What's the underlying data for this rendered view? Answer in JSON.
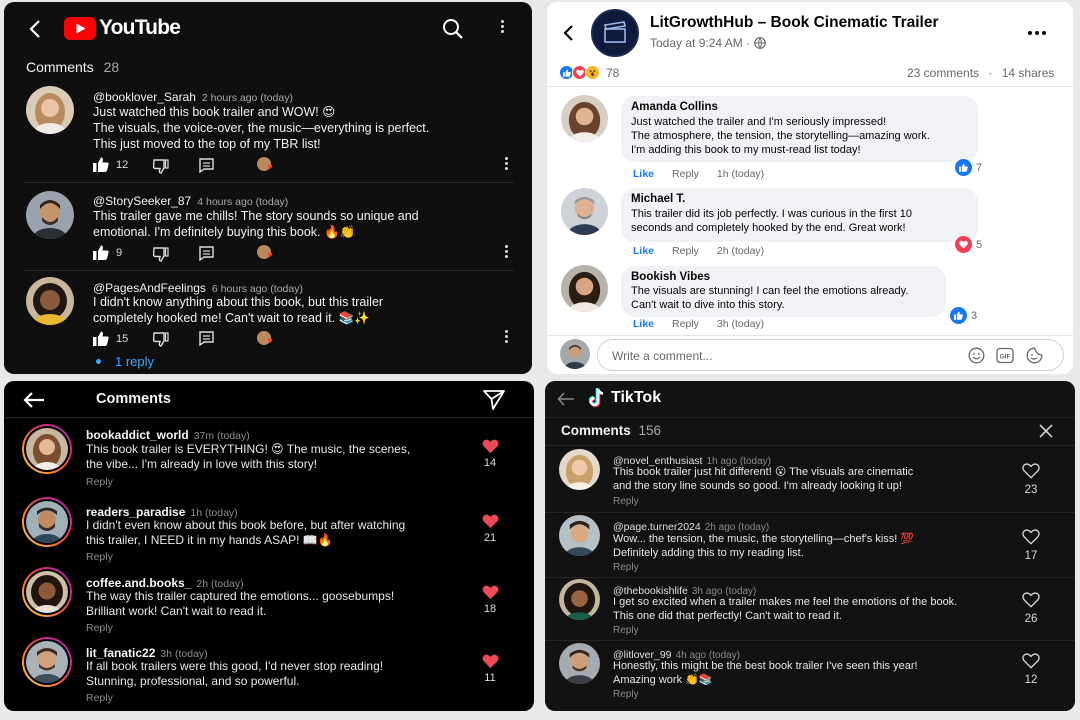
{
  "youtube": {
    "logo_text": "YouTube",
    "comments_label": "Comments",
    "comments_count": "28",
    "comments": [
      {
        "user": "@booklover_Sarah",
        "time": "2 hours ago (today)",
        "line1": "Just watched this book trailer and WOW! 😍",
        "line2": "The visuals, the voice-over, the music—everything is perfect.",
        "line3": "This just moved to the top of my TBR list!",
        "likes": "12"
      },
      {
        "user": "@StorySeeker_87",
        "time": "4 hours ago (today)",
        "line1": "This trailer gave me chills! The story sounds so unique and",
        "line2": "emotional. I'm definitely buying this book. 🔥👏",
        "line3": "",
        "likes": "9"
      },
      {
        "user": "@PagesAndFeelings",
        "time": "6 hours ago (today)",
        "line1": "I didn't know anything about this book, but this trailer",
        "line2": "completely hooked me! Can't wait to read it. 📚✨",
        "line3": "",
        "likes": "15"
      }
    ],
    "reply_link": "1 reply"
  },
  "facebook": {
    "page_name": "LitGrowthHub – Book Cinematic Trailer",
    "post_time": "Today at 9:24 AM ·",
    "reaction_count": "78",
    "comments_count": "23 comments",
    "shares_count": "14 shares",
    "like_label": "Like",
    "reply_label": "Reply",
    "comments": [
      {
        "name": "Amanda Collins",
        "line1": "Just watched the trailer and I'm seriously impressed!",
        "line2": "The atmosphere, the tension, the storytelling—amazing work.",
        "line3": "I'm adding this book to my must-read list today!",
        "time": "1h (today)",
        "reacts": "7"
      },
      {
        "name": "Michael T.",
        "line1": "This trailer did its job perfectly. I was curious in the first 10",
        "line2": "seconds and completely hooked by the end. Great work!",
        "line3": "",
        "time": "2h (today)",
        "reacts": "5"
      },
      {
        "name": "Bookish Vibes",
        "line1": "The visuals are stunning! I can feel the emotions already.",
        "line2": "Can't wait to dive into this story.",
        "line3": "",
        "time": "3h (today)",
        "reacts": "3"
      }
    ],
    "write_placeholder": "Write a comment..."
  },
  "instagram": {
    "title": "Comments",
    "reply_label": "Reply",
    "comments": [
      {
        "user": "bookaddict_world",
        "time": "37m (today)",
        "line1": "This book trailer is EVERYTHING! 😍 The music, the scenes,",
        "line2": "the vibe... I'm already in love with this story!",
        "likes": "14"
      },
      {
        "user": "readers_paradise",
        "time": "1h (today)",
        "line1": "I didn't even know about this book before, but after watching",
        "line2": "this trailer, I NEED it in my hands ASAP! 📖🔥",
        "likes": "21"
      },
      {
        "user": "coffee.and.books_",
        "time": "2h (today)",
        "line1": "The way this trailer captured the emotions... goosebumps!",
        "line2": "Brilliant work! Can't wait to read it.",
        "likes": "18"
      },
      {
        "user": "lit_fanatic22",
        "time": "3h (today)",
        "line1": "If all book trailers were this good, I'd never stop reading!",
        "line2": "Stunning, professional, and so powerful.",
        "likes": "11"
      }
    ]
  },
  "tiktok": {
    "logo_text": "TikTok",
    "comments_label": "Comments",
    "comments_count": "156",
    "reply_label": "Reply",
    "comments": [
      {
        "user": "@novel_enthusiast",
        "time": "1h ago (today)",
        "line1": "This book trailer just hit different! 😮 The visuals are cinematic",
        "line2": "and the story line sounds so good. I'm already looking it up!",
        "likes": "23"
      },
      {
        "user": "@page.turner2024",
        "time": "2h ago (today)",
        "line1": "Wow... the tension, the music, the storytelling—chef's kiss! 💯",
        "line2": "Definitely adding this to my reading list.",
        "likes": "17"
      },
      {
        "user": "@thebookishlife",
        "time": "3h ago (today)",
        "line1": "I get so excited when a trailer makes me feel the emotions of the book.",
        "line2": "This one did that perfectly! Can't wait to read it.",
        "likes": "26"
      },
      {
        "user": "@litlover_99",
        "time": "4h ago (today)",
        "line1": "Honestly, this might be the best book trailer I've seen this year!",
        "line2": "Amazing work 👏📚",
        "likes": "12"
      }
    ]
  },
  "colors": {
    "youtube_red": "#ff0000",
    "facebook_blue": "#1877f2",
    "instagram_heart": "#ed4956"
  }
}
